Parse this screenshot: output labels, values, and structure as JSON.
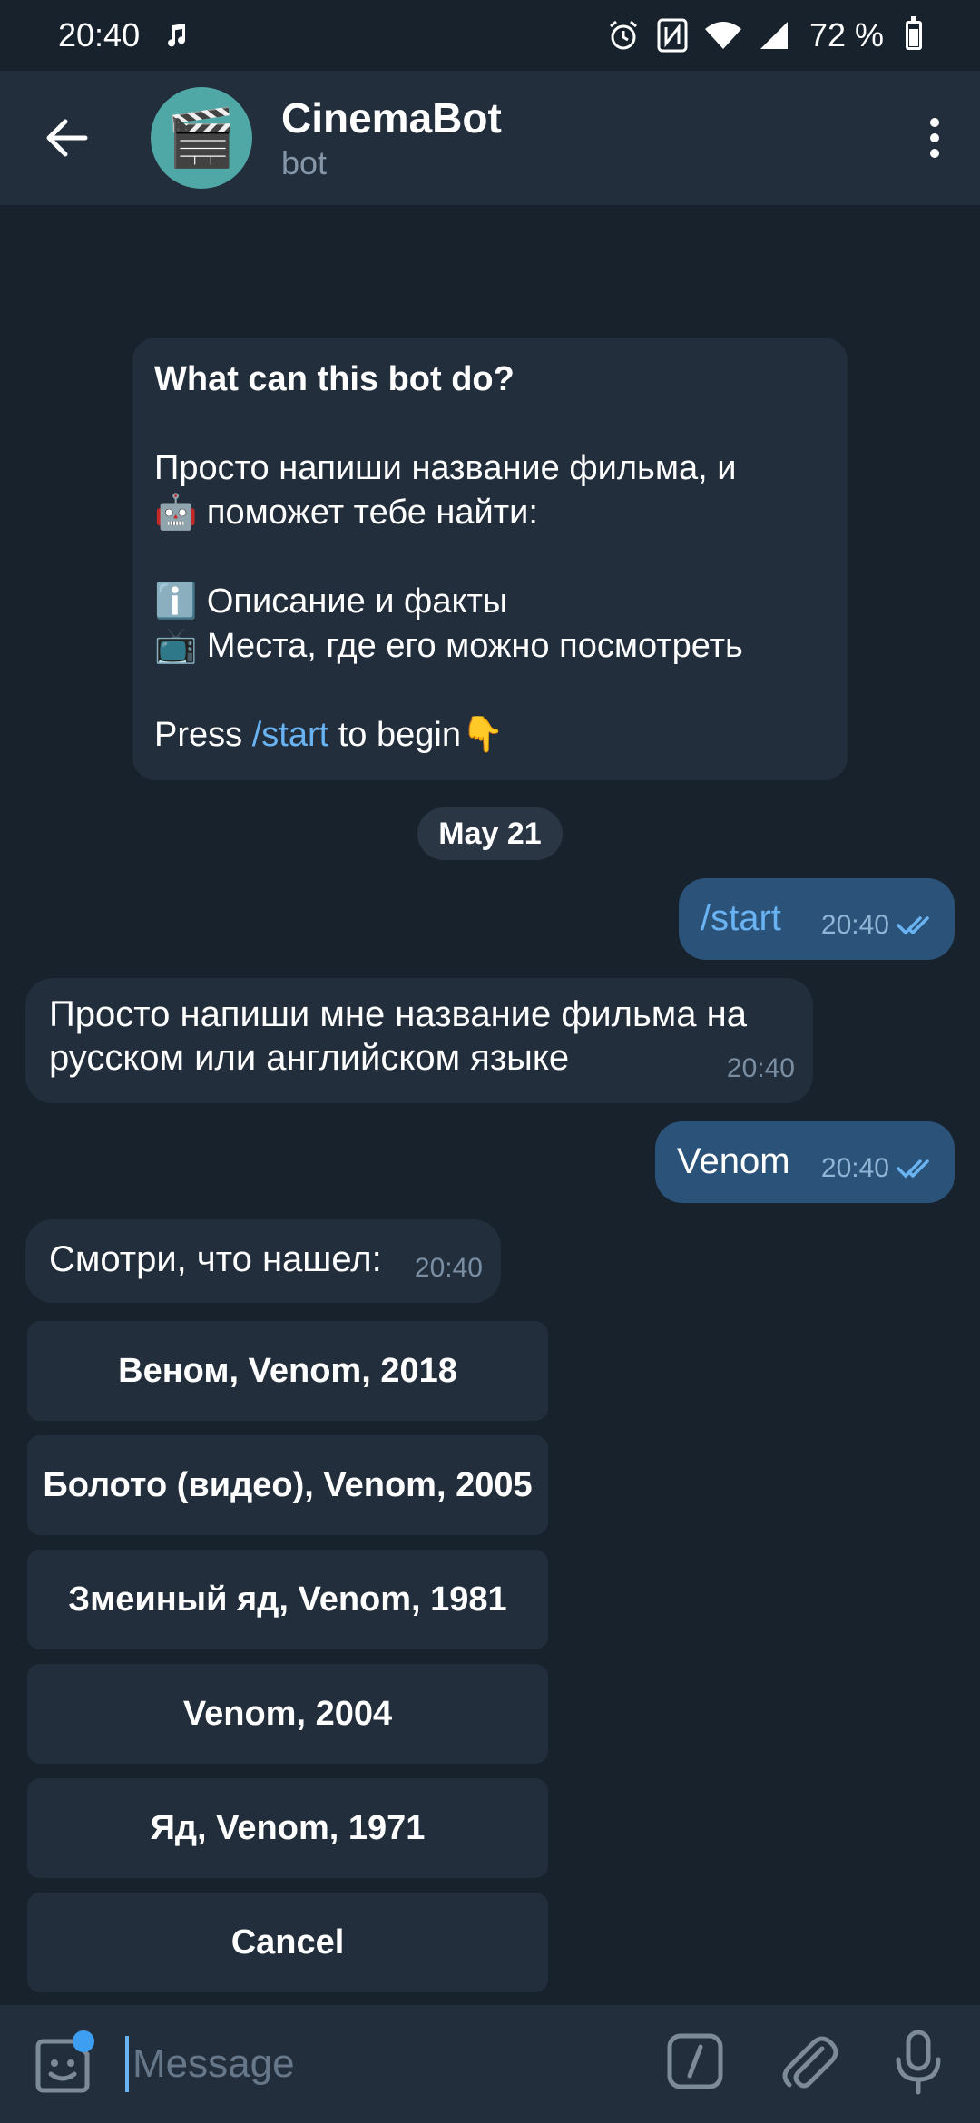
{
  "status_bar": {
    "time": "20:40",
    "music_icon": "music-note-icon",
    "battery_text": "72 %",
    "battery_level": 0.72
  },
  "header": {
    "title": "CinemaBot",
    "subtitle": "bot",
    "avatar_icon": "clapperboard-icon",
    "avatar_color": "#4fa8a6"
  },
  "intro": {
    "title": "What can this bot do?",
    "line1": "Просто напиши название фильма, и",
    "line2": "🤖 поможет тебе найти:",
    "line3": "ℹ️ Описание и факты",
    "line4": "📺 Места, где его можно посмотреть",
    "press": "Press ",
    "start_cmd": "/start",
    "to_begin": " to begin👇"
  },
  "date_separator": "May 21",
  "messages": [
    {
      "direction": "out",
      "text": "/start",
      "time": "20:40",
      "status": "read"
    },
    {
      "direction": "in",
      "text_line1": "Просто напиши мне название фильма на",
      "text_line2": "русском или английском языке",
      "time": "20:40"
    },
    {
      "direction": "out",
      "text": "Venom",
      "time": "20:40",
      "status": "read"
    },
    {
      "direction": "in",
      "text": "Смотри, что нашел:",
      "time": "20:40"
    }
  ],
  "keyboard_buttons": [
    "Веном, Venom, 2018",
    "Болото (видео), Venom, 2005",
    "Змеиный яд, Venom, 1981",
    "Venom, 2004",
    "Яд, Venom, 1971",
    "Cancel"
  ],
  "input": {
    "placeholder": "Message"
  },
  "colors": {
    "background": "#18222d",
    "panel": "#222e3c",
    "outgoing_bubble": "#2b5278",
    "link": "#6ab3f3"
  }
}
